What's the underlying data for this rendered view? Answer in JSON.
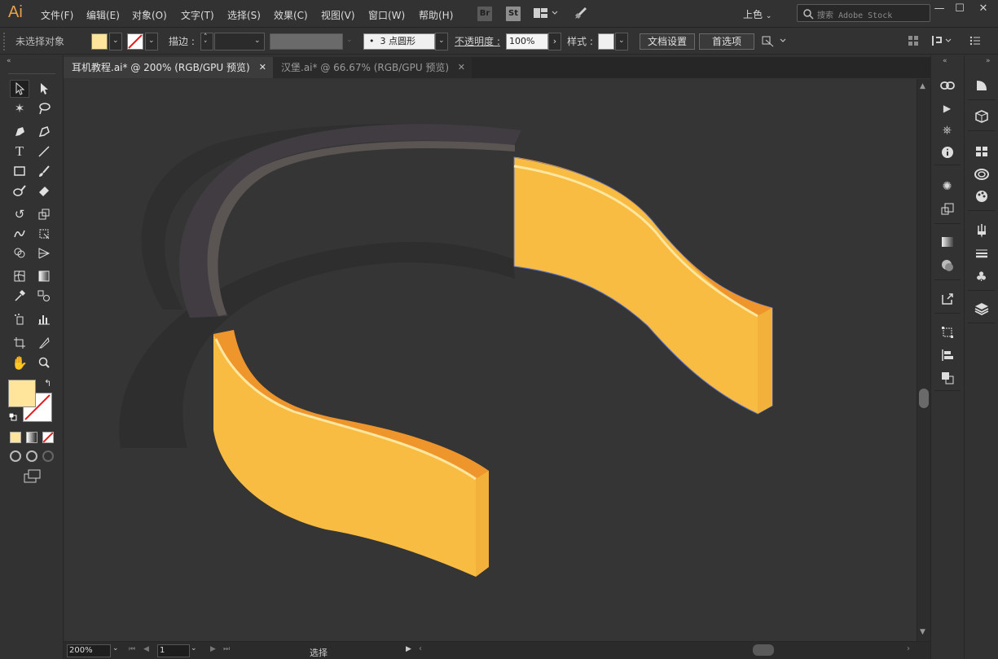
{
  "app": {
    "logo": "Ai"
  },
  "menu": [
    "文件(F)",
    "编辑(E)",
    "对象(O)",
    "文字(T)",
    "选择(S)",
    "效果(C)",
    "视图(V)",
    "窗口(W)",
    "帮助(H)"
  ],
  "menubar_icons": {
    "br": "Br",
    "st": "St"
  },
  "workspace": "上色",
  "search": {
    "placeholder": "搜索 Adobe Stock"
  },
  "window": {
    "minimize": "—",
    "maximize": "☐",
    "close": "✕"
  },
  "control": {
    "selection_status": "未选择对象",
    "stroke_label": "描边 :",
    "brush_dot": "•",
    "brush": "3 点圆形",
    "opacity_label": "不透明度 :",
    "opacity": "100%",
    "style_label": "样式 :",
    "doc_setup": "文档设置",
    "preferences": "首选项"
  },
  "tabs": [
    {
      "label": "耳机教程.ai* @ 200% (RGB/GPU 预览)",
      "close": "✕",
      "active": true
    },
    {
      "label": "汉堡.ai* @ 66.67% (RGB/GPU 预览)",
      "close": "✕",
      "active": false
    }
  ],
  "status": {
    "zoom": "200%",
    "page": "1",
    "tool": "选择"
  },
  "colors": {
    "fill": "#ffe49b",
    "accent_orange": "#f7bc41",
    "accent_dark_orange": "#ee952c",
    "highlight": "#fde6a0",
    "band_dark": "#403c41",
    "band_edge": "#5a5452",
    "shadow": "#2d2d2d",
    "canvas": "#353535",
    "selection_outline": "#5b72c8"
  },
  "toolbar_icons": [
    "selection-icon",
    "direct-selection-icon",
    "magic-wand-icon",
    "lasso-icon",
    "pen-icon",
    "curvature-icon",
    "type-icon",
    "line-icon",
    "rectangle-icon",
    "paintbrush-icon",
    "blob-brush-icon",
    "eraser-icon",
    "rotate-icon",
    "scale-icon",
    "warp-icon",
    "free-transform-icon",
    "shape-builder-icon",
    "perspective-icon",
    "mesh-icon",
    "gradient-icon",
    "eyedropper-icon",
    "blend-icon",
    "symbol-sprayer-icon",
    "graph-icon",
    "artboard-icon",
    "slice-icon",
    "hand-icon",
    "zoom-icon"
  ],
  "panel_icons": [
    "links-icon",
    "actions-icon",
    "navigator-icon",
    "info-icon",
    "symbols-icon",
    "transform-icon",
    "gradient-icon",
    "transparency-icon",
    "export-icon",
    "artboards-icon",
    "align-icon",
    "pathfinder-icon",
    "properties-icon",
    "libraries-icon",
    "swatches-icon",
    "cc-libraries-icon",
    "color-themes-icon",
    "brushes-icon",
    "stroke-icon",
    "symbols-club-icon",
    "layers-icon"
  ]
}
